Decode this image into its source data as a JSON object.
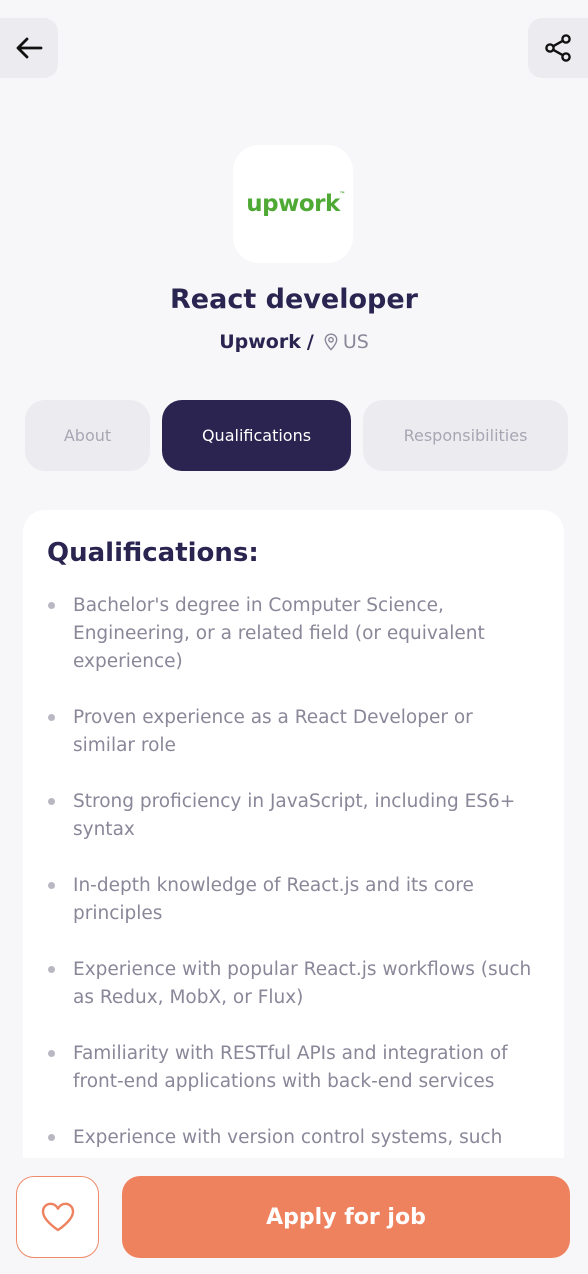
{
  "header": {
    "back_icon": "arrow-left-icon",
    "share_icon": "share-icon"
  },
  "company": {
    "logo_text": "upwork",
    "logo_tm": "™",
    "name": "Upwork",
    "separator": "/",
    "location": "US",
    "location_icon": "location-pin-icon",
    "brand_color": "#4fa935"
  },
  "job": {
    "title": "React developer"
  },
  "tabs": [
    {
      "label": "About",
      "active": false
    },
    {
      "label": "Qualifications",
      "active": true
    },
    {
      "label": "Responsibilities",
      "active": false
    }
  ],
  "qualifications": {
    "heading": "Qualifications:",
    "items": [
      "Bachelor's degree in Computer Science, Engineering, or a related field (or equivalent experience)",
      "Proven experience as a React Developer or similar role",
      "Strong proficiency in JavaScript, including ES6+ syntax",
      "In-depth knowledge of React.js and its core principles",
      "Experience with popular React.js workflows (such as Redux, MobX, or Flux)",
      "Familiarity with RESTful APIs and integration of front-end applications with back-end services",
      "Experience with version control systems, such"
    ]
  },
  "actions": {
    "favorite_icon": "heart-icon",
    "apply_label": "Apply for job"
  },
  "colors": {
    "accent": "#ef825e",
    "primary_dark": "#2b2450",
    "muted_text": "#8a8799"
  }
}
